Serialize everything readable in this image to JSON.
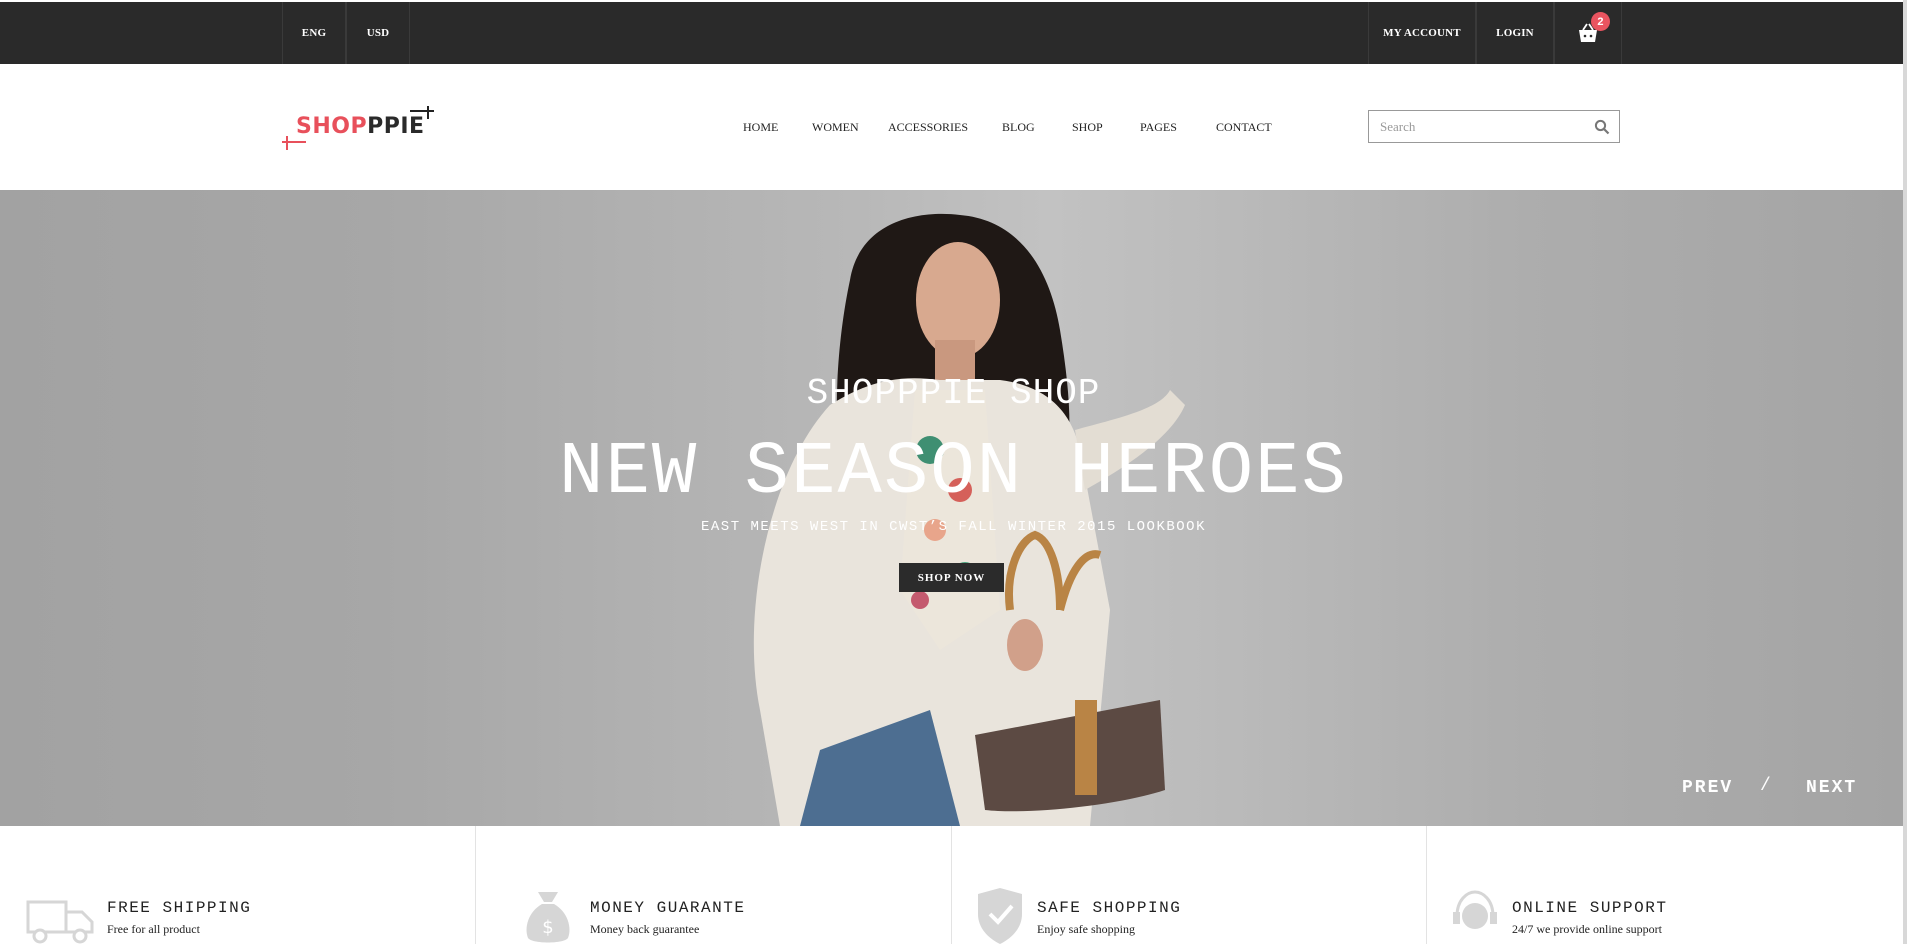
{
  "topbar": {
    "language": "ENG",
    "currency": "USD",
    "my_account": "MY ACCOUNT",
    "login": "LOGIN",
    "cart_count": "2"
  },
  "header": {
    "logo": {
      "part1": "SHOP",
      "part2": "PPIE"
    },
    "nav": [
      "HOME",
      "WOMEN",
      "ACCESSORIES",
      "BLOG",
      "SHOP",
      "PAGES",
      "CONTACT"
    ],
    "search_placeholder": "Search"
  },
  "hero": {
    "subtitle": "SHOPPPIE SHOP",
    "title": "NEW SEASON HEROES",
    "tagline": "EAST MEETS WEST IN CWST’S FALL WINTER 2015 LOOKBOOK",
    "cta": "SHOP NOW",
    "prev": "PREV",
    "separator": "/",
    "next": "NEXT"
  },
  "features": [
    {
      "icon": "truck-icon",
      "title": "FREE SHIPPING",
      "desc": "Free for all product"
    },
    {
      "icon": "money-bag-icon",
      "title": "MONEY GUARANTE",
      "desc": "Money back guarantee"
    },
    {
      "icon": "shield-check-icon",
      "title": "SAFE SHOPPING",
      "desc": "Enjoy safe shopping"
    },
    {
      "icon": "support-agent-icon",
      "title": "ONLINE SUPPORT",
      "desc": "24/7 we provide online support"
    }
  ],
  "colors": {
    "accent": "#e8505b",
    "dark": "#2a2a2a",
    "hero_bg": "#a8a8a8"
  }
}
